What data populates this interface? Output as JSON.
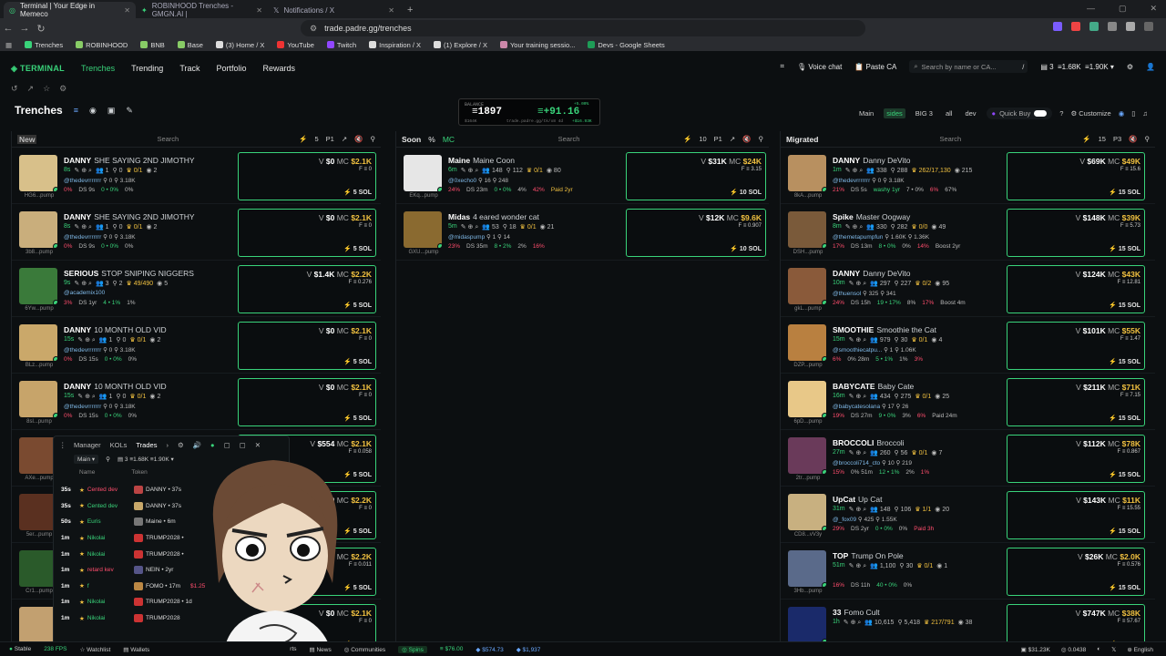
{
  "browser": {
    "tabs": [
      {
        "label": "Terminal | Your Edge in Memeco"
      },
      {
        "label": "ROBINHOOD Trenches - GMGN.AI |"
      },
      {
        "label": "Notifications / X"
      }
    ],
    "url": "trade.padre.gg/trenches",
    "bookmarks": [
      "Trenches",
      "ROBINHOOD",
      "BNB",
      "Base",
      "(3) Home / X",
      "YouTube",
      "Twitch",
      "Inspiration / X",
      "(1) Explore / X",
      "Your training sessio...",
      "Devs - Google Sheets"
    ]
  },
  "nav": {
    "logo": "TERMINAL",
    "items": [
      "Trenches",
      "Trending",
      "Track",
      "Portfolio",
      "Rewards"
    ],
    "voice": "Voice chat",
    "paste": "Paste CA",
    "search_placeholder": "Search by name or CA...",
    "search_key": "/",
    "stat1": "3",
    "stat2": "1.68K",
    "stat3": "1.90K"
  },
  "page": {
    "title": "Trenches",
    "filters": [
      "Main",
      "sides",
      "BIG 3",
      "all",
      "dev"
    ],
    "quickbuy": "Quick Buy",
    "customize": "Customize"
  },
  "balance": {
    "label": "BALANCE",
    "value": "1897",
    "delta": "+91.16",
    "sub1": "$164K",
    "sub2": "trade.padre.gg/tk/x8 4d",
    "sub3": "+5.00%",
    "sub4": "+$16.93K"
  },
  "columns": [
    {
      "title": "New",
      "search": "Search",
      "count": "5",
      "preset": "P1"
    },
    {
      "title": "Soon",
      "pct": "%",
      "mc": "MC",
      "search": "Search",
      "count": "10",
      "preset": "P1"
    },
    {
      "title": "Migrated",
      "search": "Search",
      "count": "15",
      "preset": "P3"
    }
  ],
  "new_cards": [
    {
      "ticker": "DANNY",
      "name": "SHE SAYING 2ND JIMOTHY",
      "age": "8s",
      "h": "1",
      "r": "0",
      "s": "0/1",
      "w": "2",
      "dev": "@thedevrrrrrrr",
      "f": "0",
      "mk": "3.18K",
      "p1": "0%",
      "p2": "DS 9s",
      "p3": "0 • 0%",
      "p4": "0%",
      "v": "$0",
      "mcv": "$2.1K",
      "fv": "0",
      "addr": "HG6...pump"
    },
    {
      "ticker": "DANNY",
      "name": "SHE SAYING 2ND JIMOTHY",
      "age": "8s",
      "h": "1",
      "r": "0",
      "s": "0/1",
      "w": "2",
      "dev": "@thedevrrrrrrr",
      "f": "0",
      "mk": "3.18K",
      "p1": "0%",
      "p2": "DS 9s",
      "p3": "0 • 0%",
      "p4": "0%",
      "v": "$0",
      "mcv": "$2.1K",
      "fv": "0",
      "addr": "3b8...pump"
    },
    {
      "ticker": "SERIOUS",
      "name": "STOP SNIPING NIGGERS",
      "age": "9s",
      "h": "3",
      "r": "2",
      "s": "49/490",
      "w": "5",
      "dev": "@academix100",
      "f": "",
      "mk": "",
      "p1": "3%",
      "p2": "DS 1yr",
      "p3": "4 • 1%",
      "p4": "1%",
      "v": "$1.4K",
      "mcv": "$2.2K",
      "fv": "0.276",
      "addr": "6Yw...pump"
    },
    {
      "ticker": "DANNY",
      "name": "10 MONTH OLD VID",
      "age": "15s",
      "h": "1",
      "r": "0",
      "s": "0/1",
      "w": "2",
      "dev": "@thedevrrrrrrr",
      "f": "0",
      "mk": "3.18K",
      "p1": "0%",
      "p2": "DS 15s",
      "p3": "0 • 0%",
      "p4": "0%",
      "v": "$0",
      "mcv": "$2.1K",
      "fv": "0",
      "addr": "BLz...pump"
    },
    {
      "ticker": "DANNY",
      "name": "10 MONTH OLD VID",
      "age": "15s",
      "h": "1",
      "r": "0",
      "s": "0/1",
      "w": "2",
      "dev": "@thedevrrrrrrr",
      "f": "0",
      "mk": "3.18K",
      "p1": "0%",
      "p2": "DS 15s",
      "p3": "0 • 0%",
      "p4": "0%",
      "v": "$0",
      "mcv": "$2.1K",
      "fv": "0",
      "addr": "8sl...pump"
    },
    {
      "ticker": "",
      "name": "",
      "age": "",
      "v": "$554",
      "mcv": "$2.1K",
      "fv": "0.058",
      "addr": "AXe...pump"
    },
    {
      "ticker": "",
      "name": "",
      "age": "",
      "v": "$0",
      "mcv": "$2.2K",
      "fv": "0",
      "addr": "5er...pump"
    },
    {
      "ticker": "",
      "name": "",
      "age": "",
      "v": "$0",
      "mcv": "$2.2K",
      "fv": "0.011",
      "addr": "Cr1...pump"
    },
    {
      "ticker": "",
      "name": "",
      "age": "",
      "v": "$0",
      "mcv": "$2.1K",
      "fv": "0",
      "addr": ""
    }
  ],
  "soon_cards": [
    {
      "ticker": "Maine",
      "name": "Maine Coon",
      "age": "6m",
      "h": "148",
      "r": "112",
      "s": "0/1",
      "w": "80",
      "dev": "@0xecho0",
      "f": "16",
      "mk": "248",
      "p1": "24%",
      "p2": "DS 23m",
      "p3": "0 • 0%",
      "p4": "4%",
      "p5": "42%",
      "extra": "Paid 2yr",
      "v": "$31K",
      "mcv": "$24K",
      "fv": "3.15",
      "sol": "10 SOL",
      "addr": "EKq...pump"
    },
    {
      "ticker": "Midas",
      "name": "4 eared wonder cat",
      "age": "5m",
      "h": "53",
      "r": "18",
      "s": "0/1",
      "w": "21",
      "dev": "@midaspump",
      "f": "1",
      "mk": "14",
      "p1": "23%",
      "p2": "DS 35m",
      "p3": "8 • 2%",
      "p4": "2%",
      "p5": "16%",
      "extra": "",
      "v": "$12K",
      "mcv": "$9.6K",
      "fv": "0.907",
      "sol": "10 SOL",
      "addr": "GXU...pump"
    }
  ],
  "mig_cards": [
    {
      "ticker": "DANNY",
      "name": "Danny DeVito",
      "age": "1m",
      "h": "338",
      "r": "288",
      "s": "262/17,130",
      "w": "215",
      "dev": "@thedevrrrrrrr",
      "f": "0",
      "mk": "3.18K",
      "p1": "21%",
      "p2": "DS 5s",
      "p3": "washy 1yr",
      "p4": "7 • 0%",
      "p5": "6%",
      "p6": "67%",
      "v": "$69K",
      "mcv": "$49K",
      "fv": "15.6",
      "addr": "8kA...pump"
    },
    {
      "ticker": "Spike",
      "name": "Master Oogway",
      "age": "8m",
      "h": "330",
      "r": "282",
      "s": "0/0",
      "w": "49",
      "dev": "@themetapumpfun",
      "f": "1.60K",
      "mk": "1.36K",
      "p1": "17%",
      "p2": "DS 13m",
      "p3": "8 • 0%",
      "p4": "0%",
      "p5": "14%",
      "p6": "Boost 2yr",
      "v": "$148K",
      "mcv": "$39K",
      "fv": "5.73",
      "addr": "DSH...pump"
    },
    {
      "ticker": "DANNY",
      "name": "Danny DeVito",
      "age": "10m",
      "h": "297",
      "r": "227",
      "s": "0/2",
      "w": "95",
      "dev": "@thuensol",
      "f": "325",
      "mk": "341",
      "p1": "24%",
      "p2": "DS 15h",
      "p3": "19 • 17%",
      "p4": "8%",
      "p5": "17%",
      "p6": "Boost 4m",
      "v": "$124K",
      "mcv": "$43K",
      "fv": "12.81",
      "addr": "gkL...pump"
    },
    {
      "ticker": "SMOOTHIE",
      "name": "Smoothie the Cat",
      "age": "15m",
      "h": "979",
      "r": "30",
      "s": "0/1",
      "w": "4",
      "dev": "@smoothiecatpu...",
      "f": "1",
      "mk": "1.06K",
      "p1": "6%",
      "p2": "0% 28m",
      "p3": "5 • 1%",
      "p4": "1%",
      "p5": "3%",
      "p6": "",
      "v": "$101K",
      "mcv": "$55K",
      "fv": "1.47",
      "addr": "DZP...pump"
    },
    {
      "ticker": "BABYCATE",
      "name": "Baby Cate",
      "age": "16m",
      "h": "434",
      "r": "275",
      "s": "0/1",
      "w": "25",
      "dev": "@babycatesolana",
      "f": "17",
      "mk": "26",
      "p1": "19%",
      "p2": "DS 27m",
      "p3": "9 • 0%",
      "p4": "3%",
      "p5": "6%",
      "p6": "Paid 24m",
      "v": "$211K",
      "mcv": "$71K",
      "fv": "7.15",
      "addr": "6pD...pump"
    },
    {
      "ticker": "BROCCOLI",
      "name": "Broccoli",
      "age": "27m",
      "h": "260",
      "r": "56",
      "s": "0/1",
      "w": "7",
      "dev": "@broccoli714_cto",
      "f": "10",
      "mk": "219",
      "p1": "15%",
      "p2": "0% 51m",
      "p3": "12 • 1%",
      "p4": "2%",
      "p5": "1%",
      "p6": "",
      "v": "$112K",
      "mcv": "$78K",
      "fv": "0.867",
      "addr": "2tr...pump"
    },
    {
      "ticker": "UpCat",
      "name": "Up Cat",
      "age": "31m",
      "h": "148",
      "r": "106",
      "s": "1/1",
      "w": "20",
      "dev": "@_fox09",
      "f": "425",
      "mk": "1.55K",
      "p1": "29%",
      "p2": "DS 2yr",
      "p3": "0 • 0%",
      "p4": "0%",
      "p5": "Paid 3h",
      "p6": "",
      "v": "$143K",
      "mcv": "$11K",
      "fv": "15.55",
      "addr": "CD8...vV3y"
    },
    {
      "ticker": "TOP",
      "name": "Trump On Pole",
      "age": "51m",
      "h": "1,100",
      "r": "30",
      "s": "0/1",
      "w": "1",
      "dev": "",
      "f": "",
      "mk": "",
      "p1": "16%",
      "p2": "DS 11h",
      "p3": "40 • 0%",
      "p4": "0%",
      "p5": "",
      "p6": "",
      "v": "$26K",
      "mcv": "$2.0K",
      "fv": "0.576",
      "addr": "3Hb...pump"
    },
    {
      "ticker": "33",
      "name": "Fomo Cult",
      "age": "1h",
      "h": "10,615",
      "r": "5,418",
      "s": "217/791",
      "w": "38",
      "dev": "",
      "f": "",
      "mk": "",
      "p1": "",
      "p2": "",
      "p3": "",
      "p4": "",
      "p5": "",
      "p6": "",
      "v": "$747K",
      "mcv": "$38K",
      "fv": "57.67",
      "addr": ""
    }
  ],
  "sol_labels": {
    "new": "5 SOL",
    "soon": "10 SOL",
    "mig": "15 SOL"
  },
  "tracker": {
    "tabs": [
      "Manager",
      "KOLs",
      "Trades"
    ],
    "preset": "Main",
    "count": "3",
    "v1": "1.68K",
    "v2": "1.90K",
    "col_name": "Name",
    "col_token": "Token",
    "rows": [
      {
        "t": "35s",
        "name": "Cented dev",
        "token": "DANNY • 37s",
        "c": "#ff4d6d"
      },
      {
        "t": "35s",
        "name": "Cented dev",
        "token": "DANNY • 37s",
        "c": "#39d37a"
      },
      {
        "t": "50s",
        "name": "Euris",
        "token": "Maine • 6m",
        "c": "#39d37a"
      },
      {
        "t": "1m",
        "name": "Nikolai",
        "token": "TRUMP2028 •",
        "c": "#39d37a"
      },
      {
        "t": "1m",
        "name": "Nikolai",
        "token": "TRUMP2028 •",
        "c": "#39d37a"
      },
      {
        "t": "1m",
        "name": "retard kev",
        "token": "NEIN • 2yr",
        "c": "#ff4d6d"
      },
      {
        "t": "1m",
        "name": "f",
        "token": "FOMO • 17m",
        "c": "#39d37a",
        "extra": "$1.25"
      },
      {
        "t": "1m",
        "name": "Nikolai",
        "token": "TRUMP2028 • 1d",
        "c": "#39d37a"
      },
      {
        "t": "1m",
        "name": "Nikolai",
        "token": "TRUMP2028",
        "c": "#39d37a"
      }
    ]
  },
  "status": {
    "stable": "Stable",
    "fps": "238 FPS",
    "items": [
      "Watchlist",
      "Wallets",
      "rts",
      "News",
      "Communities",
      "Spins"
    ],
    "sol": "$76.00",
    "eth": "$574.73",
    "btc": "$1,937",
    "right1": "$31.23K",
    "right2": "0.0438",
    "lang": "English"
  }
}
